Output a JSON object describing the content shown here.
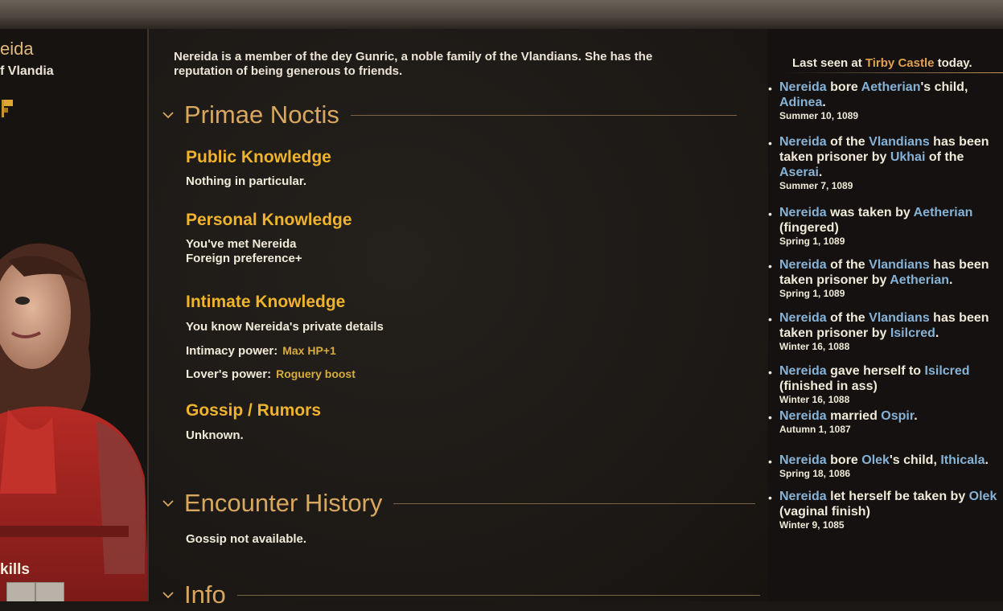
{
  "left_panel": {
    "name": "eida",
    "subtitle": "f Vlandia",
    "skills_label": "kills"
  },
  "main": {
    "intro": "Nereida is a member of the dey Gunric, a noble family of the Vlandians. She has the reputation of being generous to friends.",
    "sections": {
      "primae": "Primae Noctis",
      "encounter": "Encounter History",
      "info": "Info"
    },
    "public": {
      "heading": "Public Knowledge",
      "text": "Nothing in particular."
    },
    "personal": {
      "heading": "Personal Knowledge",
      "line1": "You've met Nereida",
      "line2": "Foreign preference+"
    },
    "intimate": {
      "heading": "Intimate Knowledge",
      "line1": "You know Nereida's private details",
      "power_label": "Intimacy power:",
      "power_value": "Max HP+1",
      "lover_label": "Lover's power:",
      "lover_value": "Roguery boost"
    },
    "gossip": {
      "heading": "Gossip / Rumors",
      "text": "Unknown."
    },
    "encounter_text": "Gossip not available."
  },
  "right_panel": {
    "last_seen_prefix": "Last seen at ",
    "last_seen_place": "Tirby Castle",
    "last_seen_suffix": " today.",
    "events": [
      {
        "date": "Summer 10, 1089"
      },
      {
        "date": "Summer 7, 1089"
      },
      {
        "date": "Spring 1, 1089"
      },
      {
        "date": "Spring 1, 1089"
      },
      {
        "date": "Winter 16, 1088"
      },
      {
        "date": "Winter 16, 1088"
      },
      {
        "date": "Autumn 1, 1087"
      },
      {
        "date": "Spring 18, 1086"
      },
      {
        "date": "Winter 9, 1085"
      }
    ],
    "names": {
      "nereida": "Nereida",
      "aetherian": "Aetherian",
      "adinea": "Adinea",
      "vlandians": "Vlandians",
      "ukhai": "Ukhai",
      "aserai": "Aserai",
      "isilcred": "Isilcred",
      "ospir": "Ospir",
      "olek": "Olek",
      "ithicala": "Ithicala"
    },
    "phrases": {
      "bore": " bore ",
      "child": "'s child,",
      "child2": "'s child, ",
      "of_the": " of the ",
      "has_been": " has been",
      "taken_by": "taken prisoner by ",
      "of_the2": " of the",
      "was_taken": " was taken by ",
      "fingered": "(fingered)",
      "gave": " gave herself to ",
      "finished_ass": "(finished in ass)",
      "married": " married ",
      "let_herself": " let herself be taken by ",
      "vaginal": "(vaginal finish)",
      "period": "."
    }
  },
  "colors": {
    "accent_gold": "#efb32c",
    "section_title": "#d8a760",
    "link_blue": "#86b2d6",
    "link_orange": "#e0a050"
  }
}
